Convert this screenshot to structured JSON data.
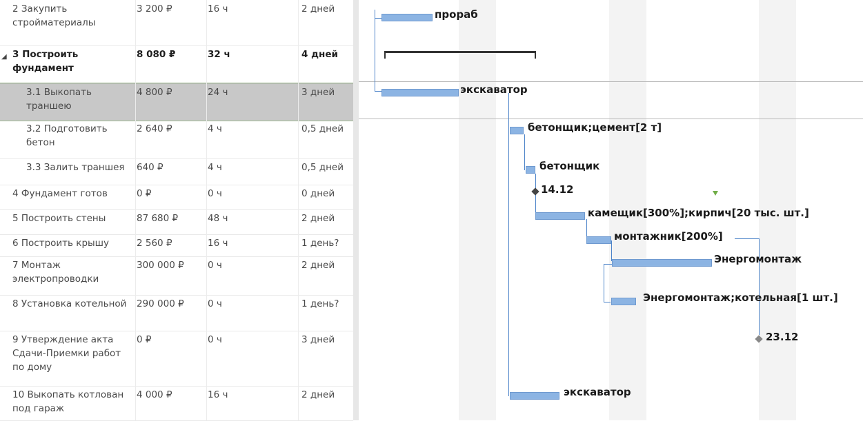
{
  "tasks": [
    {
      "name": "2 Закупить стройматериалы",
      "cost": "3 200 ₽",
      "work": "16 ч",
      "duration": "2 дней",
      "type": "normal",
      "marker": ""
    },
    {
      "name": "3 Построить фундамент",
      "cost": "8 080 ₽",
      "work": "32 ч",
      "duration": "4 дней",
      "type": "summary",
      "marker": "◢"
    },
    {
      "name": "3.1 Выкопать траншею",
      "cost": "4 800 ₽",
      "work": "24 ч",
      "duration": "3 дней",
      "type": "selected",
      "marker": ""
    },
    {
      "name": "3.2 Подготовить бетон",
      "cost": "2 640 ₽",
      "work": "4 ч",
      "duration": "0,5 дней",
      "type": "normal",
      "marker": ""
    },
    {
      "name": "3.3 Залить траншея",
      "cost": "640 ₽",
      "work": "4 ч",
      "duration": "0,5 дней",
      "type": "normal",
      "marker": ""
    },
    {
      "name": "4 Фундамент готов",
      "cost": "0 ₽",
      "work": "0 ч",
      "duration": "0 дней",
      "type": "normal",
      "marker": ""
    },
    {
      "name": "5 Построить стены",
      "cost": "87 680 ₽",
      "work": "48 ч",
      "duration": "2 дней",
      "type": "normal",
      "marker": ""
    },
    {
      "name": "6 Построить крышу",
      "cost": "2 560 ₽",
      "work": "16 ч",
      "duration": "1 день?",
      "type": "normal",
      "marker": ""
    },
    {
      "name": "7 Монтаж электропроводки",
      "cost": "300 000 ₽",
      "work": "0 ч",
      "duration": "2 дней",
      "type": "normal",
      "marker": ""
    },
    {
      "name": "8 Установка котельной",
      "cost": "290 000 ₽",
      "work": "0 ч",
      "duration": "1 день?",
      "type": "normal",
      "marker": ""
    },
    {
      "name": "9 Утверждение акта Сдачи-Приемки работ по дому",
      "cost": "0 ₽",
      "work": "0 ч",
      "duration": "3 дней",
      "type": "normal",
      "marker": ""
    },
    {
      "name": "10 Выкопать котлован под гараж",
      "cost": "4 000 ₽",
      "work": "16 ч",
      "duration": "2 дней",
      "type": "normal",
      "marker": ""
    }
  ],
  "gantt": {
    "resource_labels": [
      "прораб",
      "экскаватор",
      "бетонщик;цемент[2 т]",
      "бетонщик",
      "камещик[300%];кирпич[20 тыс. шт.]",
      "монтажник[200%]",
      "Энергомонтаж",
      "Энергомонтаж;котельная[1 шт.]",
      "экскаватор"
    ],
    "milestone_dates": [
      "14.12",
      "23.12"
    ],
    "colors": {
      "bar_fill": "#8cb4e3",
      "link_line": "#4d84c9",
      "selected_row": "#c8c8c8",
      "weekend_stripe": "#f3f3f3",
      "split_indicator": "#70ad47"
    }
  }
}
